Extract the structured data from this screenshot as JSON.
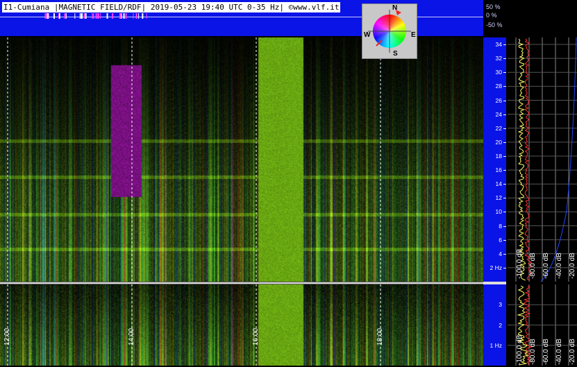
{
  "title": "I1-Cumiana |MAGNETIC FIELD/RDF| 2019-05-23 19:40 UTC 0-35 Hz| ©www.vlf.it",
  "pct_labels": [
    "50 %",
    "0 %",
    "-50 %"
  ],
  "compass": {
    "n": "N",
    "s": "S",
    "e": "E",
    "w": "W"
  },
  "colors": {
    "panel_blue": "#0a14e6",
    "background": "#000000",
    "spectrum_avg": "#ffff66",
    "spectrum_peak": "#ff3030"
  },
  "chart_data": [
    {
      "type": "heatmap",
      "title": "I1-Cumiana |MAGNETIC FIELD/RDF| 2019-05-23 19:40 UTC 0-35 Hz| ©www.vlf.it",
      "xlabel": "",
      "ylabel": "",
      "x_ticks": [
        "12:00",
        "14:00",
        "16:00",
        "18:00"
      ],
      "y_ticks": [
        "2 Hz",
        "4",
        "6",
        "8",
        "10",
        "12",
        "14",
        "16",
        "18",
        "20",
        "22",
        "24",
        "26",
        "28",
        "30",
        "32",
        "34"
      ],
      "ylim": [
        0,
        35
      ],
      "grid": true
    },
    {
      "type": "heatmap",
      "xlabel": "",
      "ylabel": "",
      "y_ticks": [
        "1 Hz",
        "2",
        "3"
      ],
      "ylim": [
        0,
        4
      ],
      "grid": true
    },
    {
      "type": "line",
      "db_ticks": [
        "-100.0 dB",
        "-80.0 dB",
        "-60.0 dB",
        "-40.0 dB",
        "-20.0 dB"
      ],
      "db_ticks_bottom": [
        "-100.0 dB",
        "-80.0 dB",
        "-60.0 dB",
        "-40.0 dB",
        "-20.0 dB"
      ],
      "grid": true
    }
  ]
}
